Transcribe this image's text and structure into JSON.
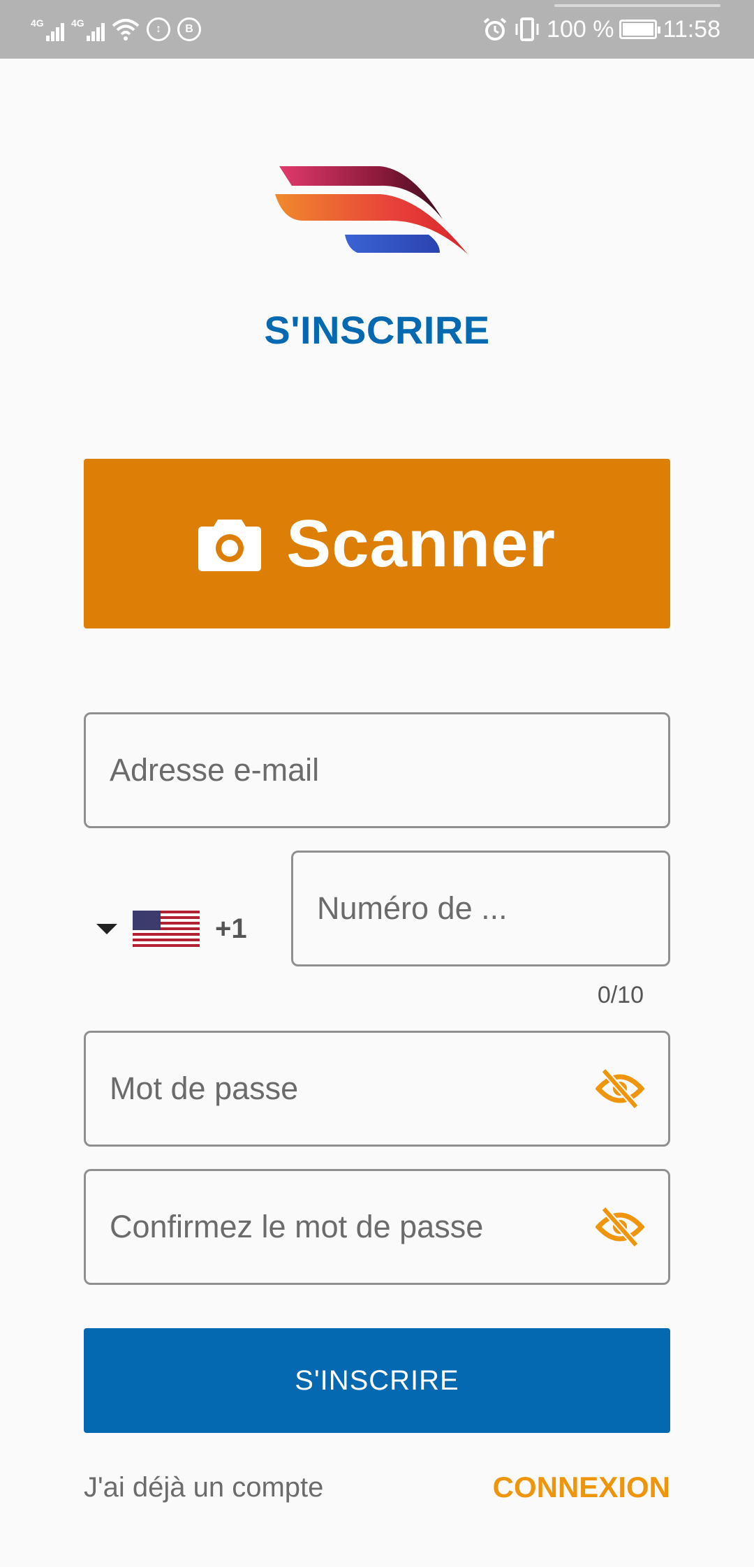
{
  "status_bar": {
    "network_1": "4G",
    "network_2": "4G",
    "battery": "100 %",
    "time": "11:58",
    "icons": [
      "signal-icon",
      "signal-icon",
      "wifi-icon",
      "data-saver-icon",
      "b-icon",
      "alarm-icon",
      "vibrate-icon",
      "battery-icon"
    ]
  },
  "header": {
    "logo": "brand-logo",
    "title": "S'INSCRIRE"
  },
  "scanner": {
    "label": "Scanner",
    "icon": "camera-icon",
    "color": "#dd7e07"
  },
  "form": {
    "email_placeholder": "Adresse e-mail",
    "country_flag": "us-flag-icon",
    "dial_code": "+1",
    "phone_placeholder": "Numéro de ...",
    "phone_counter": "0/10",
    "password_placeholder": "Mot de passe",
    "confirm_placeholder": "Confirmez le mot de passe",
    "eye_icon": "eye-off-icon"
  },
  "actions": {
    "submit_label": "S'INSCRIRE",
    "footer_text": "J'ai déjà un compte",
    "login_label": "CONNEXION"
  },
  "colors": {
    "primary": "#0569b2",
    "accent": "#ef950b",
    "scanner": "#dd7e07"
  }
}
